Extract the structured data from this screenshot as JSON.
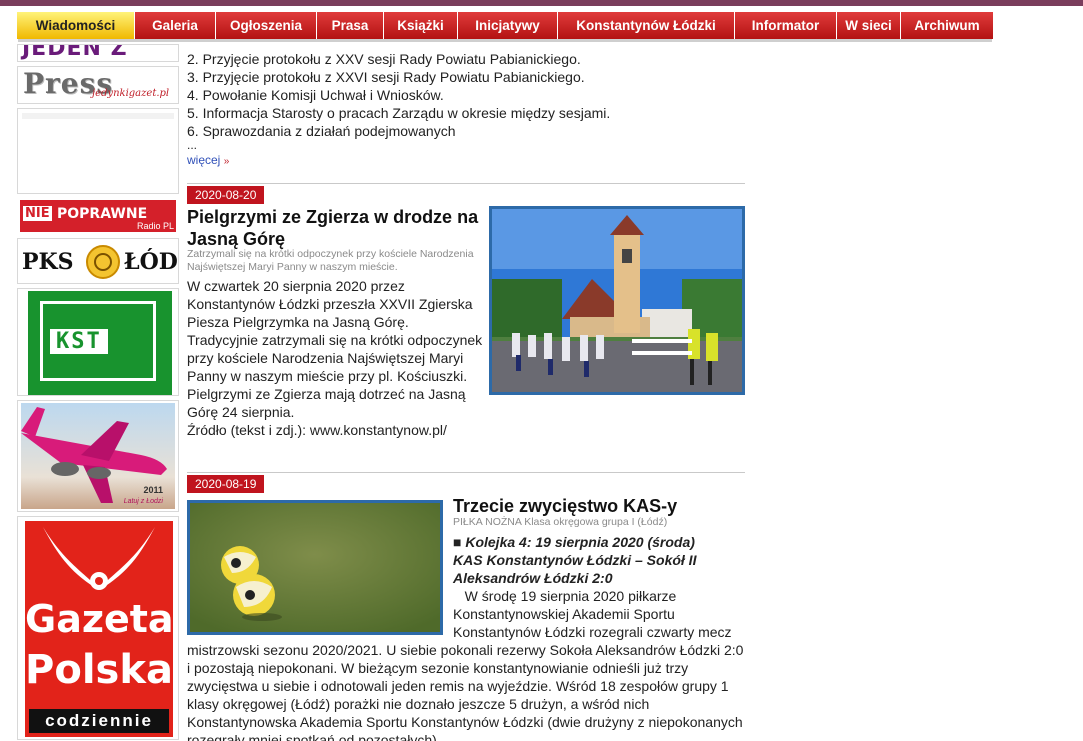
{
  "nav": {
    "items": [
      {
        "label": "Wiadomości",
        "active": true
      },
      {
        "label": "Galeria"
      },
      {
        "label": "Ogłoszenia"
      },
      {
        "label": "Prasa"
      },
      {
        "label": "Książki"
      },
      {
        "label": "Inicjatywy"
      },
      {
        "label": "Konstantynów Łódzki"
      },
      {
        "label": "Informator"
      },
      {
        "label": "W sieci"
      },
      {
        "label": "Archiwum"
      }
    ]
  },
  "banners": {
    "jeden": "JEDEN Z NAS",
    "press": {
      "main": "Press",
      "sub": "jedynkigazet.pl"
    },
    "nie": {
      "a": "NIE",
      "b": "POPRAWNE",
      "c": "Radio PL"
    },
    "pks": {
      "left": "PKS",
      "right": "ŁÓDŹ"
    },
    "kst": "KST",
    "wizz": {
      "year": "2011",
      "sub": "Latuj z Łodzi"
    },
    "gazeta": {
      "l1": "Gazeta",
      "l2": "Polska",
      "l3": "codziennie"
    }
  },
  "agenda": {
    "items": [
      "2. Przyjęcie protokołu z XXV sesji Rady Powiatu Pabianickiego.",
      "3. Przyjęcie protokołu z XXVI sesji Rady Powiatu Pabianickiego.",
      "4. Powołanie Komisji Uchwał i Wniosków.",
      "5. Informacja Starosty o pracach Zarządu w okresie między sesjami.",
      "6. Sprawozdania z działań podejmowanych"
    ],
    "ellipsis": "...",
    "more": "więcej",
    "more_mark": "»"
  },
  "articles": [
    {
      "date": "2020-08-20",
      "title": "Pielgrzymi ze Zgierza w drodze na Jasną Górę",
      "subtitle": "Zatrzymali się na krótki odpoczynek przy kościele Narodzenia Najświętszej Maryi Panny w naszym mieście.",
      "body": "W czwartek 20 sierpnia 2020 przez Konstantynów Łódzki przeszła XXVII Zgierska Piesza Pielgrzymka na Jasną Górę. Tradycyjnie zatrzymali się na krótki odpoczynek przy kościele Narodzenia Najświętszej Maryi Panny w naszym mieście przy pl. Kościuszki. Pielgrzymi ze Zgierza mają dotrzeć na Jasną Górę 24 sierpnia.",
      "source": "Źródło (tekst i zdj.): www.konstantynow.pl/"
    },
    {
      "date": "2020-08-19",
      "title": "Trzecie zwycięstwo KAS-y",
      "subtitle": "PIŁKA NOŻNA Klasa okręgowa grupa I (Łódź)",
      "lead": "■ Kolejka 4: 19 sierpnia 2020 (środa) KAS Konstantynów Łódzki – Sokół II Aleksandrów Łódzki 2:0",
      "body": "   W środę 19 sierpnia 2020 piłkarze Konstantynowskiej Akademii Sportu Konstantynów Łódzki rozegrali czwarty mecz mistrzowski sezonu 2020/2021. U siebie pokonali rezerwy Sokoła Aleksandrów Łódzki 2:0 i pozostają niepokonani. W bieżącym sezonie konstantynowianie odnieśli już trzy zwycięstwa u siebie i odnotowali jeden remis na wyjeździe. Wśród 18 zespołów grupy 1 klasy okręgowej (Łódź) porażki nie doznało jeszcze 5 drużyn, a wśród nich Konstantynowska Akademia Sportu Konstantynów Łódzki (dwie drużyny z niepokonanych rozegrały mniej spotkań od pozostałych)."
    }
  ],
  "colors": {
    "nav_red": "#c81a1a",
    "nav_active": "#f6d21a",
    "date_badge": "#c0141e",
    "photo_border": "#2d6aa8",
    "link": "#3050b8"
  }
}
